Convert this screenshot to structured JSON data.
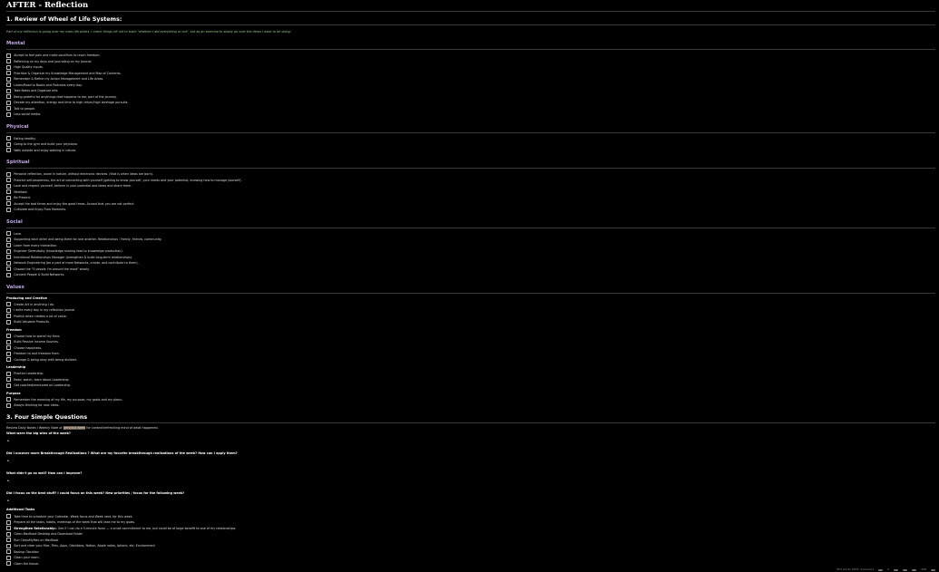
{
  "page": {
    "title": "AFTER - Reflection"
  },
  "review": {
    "heading": "1. Review of Wheel of Life Systems:",
    "intro": "Part of my reflection is going over my main life pillars. I check things off not to track \"whether I did everything or not\", but as an exercise to slowly go over the items I want to be doing:",
    "sections": [
      {
        "title": "Mental",
        "tasks": [
          "Accept to feel pain and make sacrifices to reach freedom.",
          "Reflecting on my days and journaling on my Journal.",
          "High Quality inputs.",
          "Prioritize & Organize my Knowledge Management and Map of Contents.",
          "Remember & Refine my Action Management and Life Areas.",
          "Listen/Read to Books and Podcasts every day.",
          "Take Notes and Organize Info.",
          "Being grateful for anythings that happens to me, part of the journey.",
          "Devote my attention, energy and time to high return/high leverage pursuits.",
          "Talk to people.",
          "Less social media."
        ]
      },
      {
        "title": "Physical",
        "tasks": [
          "Eating healthy.",
          "Going to the gym and build your physique.",
          "Walk outside and enjoy walking in nature."
        ]
      },
      {
        "title": "Spiritual",
        "tasks": [
          "Personal reflection, alone in nature, without electronic devices. (that is when ideas are born).",
          "Practice self-awareness, the art of connecting with yourself (getting to know yourself, your needs and your potential, knowing how to manage yourself).",
          "Love and respect yourself, believe in your potential and ideas and share them.",
          "Meditate.",
          "Be Present.",
          "Accept the bad times and enjoy the good times. Accept that you are not perfect.",
          "Cultivate and Enjoy Flow Moments."
        ]
      },
      {
        "title": "Social",
        "tasks": [
          "Love.",
          "Supporting each other and being there for one another. Relationships : Family, friends, community.",
          "Learn from every interaction.",
          "Engineer Serendipity (knowledge sharing lead to knowledge production).",
          "Intentional Relationships Manager (strengthen & build long-term relationships).",
          "Network Engineering (be a part of more Networks, create, and contribute to them).",
          "Choose the \"5 people I'm around the most\" wisely.",
          "Connect People & Build Networks."
        ]
      }
    ],
    "values": {
      "title": "Values",
      "groups": [
        {
          "title": "Producing and Creative",
          "tasks": [
            "Create Art in anything I do.",
            "I write every day in my reflection journal.",
            "Publish when creates a lot of value.",
            "Build Valuable Products."
          ]
        },
        {
          "title": "Freedom",
          "tasks": [
            "Choose how to spend my time.",
            "Build Passive Income Sources.",
            "Choose happiness.",
            "Freedom to and freedom from.",
            "Courage & being okay with being disliked."
          ]
        },
        {
          "title": "Leadership",
          "tasks": [
            "Practice Leadership",
            "Read, watch, learn about Leadership",
            "Get coached/mentored on Leadership"
          ]
        },
        {
          "title": "Purpose",
          "tasks": [
            "Remember the meaning of my life, my purpose, my goals and my plans.",
            "Always thinking for new ideas."
          ]
        }
      ]
    }
  },
  "questions": {
    "heading": "3. Four Simple Questions",
    "review_pre": "Review Daily Notes / Weekly Note of ",
    "review_highlight": "previous week",
    "review_post": " for context/refreshing mind of what happened.",
    "items": [
      "What were the big wins of the week?",
      "Did I uncover more Breakthrough Realizations ? What are my favorite breakthrough realizations of the week? How can I apply them?",
      "What didn't go so well? How can I improve?",
      "Did I focus on the best stuff? I could focus on this week? New priorities / focus for the following week?"
    ],
    "bullet_glyph": "•"
  },
  "additional": {
    "title": "Additional Tasks",
    "tasks": [
      {
        "bold": "",
        "text": "Take time to schedule your Calendar, Week focus and Week next, for this week."
      },
      {
        "bold": "",
        "text": "Prepare all the tasks, habits, meetings of the week that will lead me to my goals."
      },
      {
        "bold": "Strengthen Relationship:",
        "text": " - See if I can do a 5-minute favor — a small commitment to me, but could be of large benefit to one of my relationships."
      },
      {
        "bold": "",
        "text": "Clean MacBook Desktop and Download Folder"
      },
      {
        "bold": "",
        "text": "Run CleanMyMac on MacBook"
      },
      {
        "bold": "",
        "text": "Sort and clear your Mac, Files, Apps, Obsidians, Notion, Apple notes, Iphone, etc. Environment"
      },
      {
        "bold": "",
        "text": "Backup Obsidian"
      },
      {
        "bold": "",
        "text": "Clean your room."
      },
      {
        "bold": "",
        "text": "Clean the house."
      }
    ]
  },
  "statusbar": {
    "counts": "853 words 5633 characters",
    "extra_a": "0",
    "extra_b": "208"
  },
  "colors": {
    "background": "#000000",
    "section_heading": "#c3a4ec",
    "intro_text": "#8fd18f",
    "highlight": "#6b5e4e"
  }
}
